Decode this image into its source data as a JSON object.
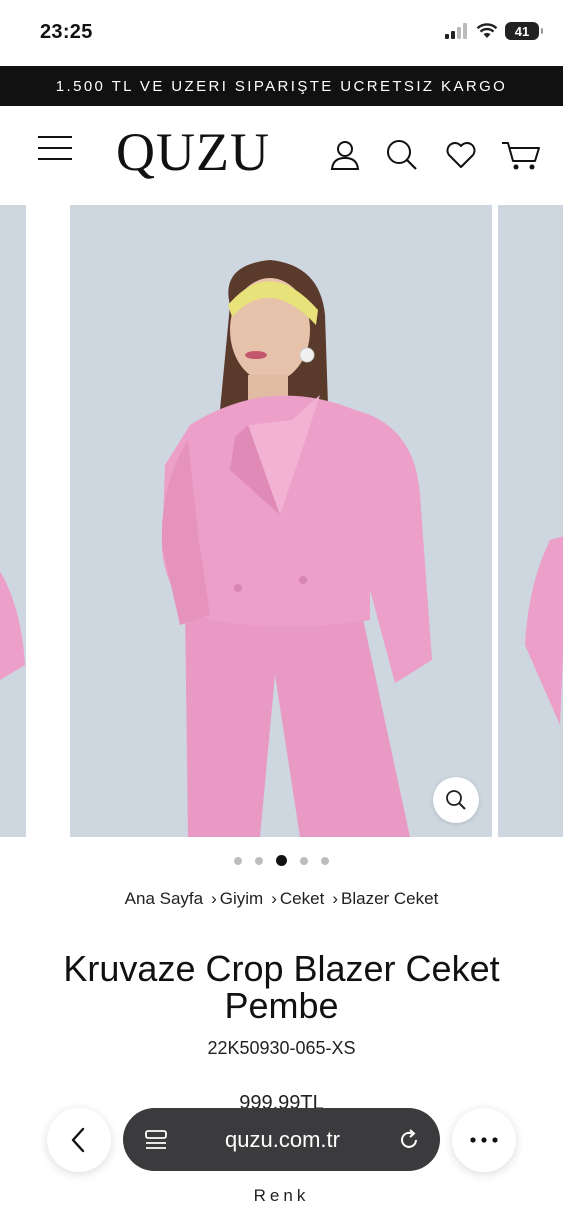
{
  "status_bar": {
    "time": "23:25",
    "battery": "41"
  },
  "promo": {
    "text": "1.500 TL VE UZERI SIPARIŞTE UCRETSIZ KARGO"
  },
  "header": {
    "logo": "QUZU"
  },
  "breadcrumb": [
    "Ana Sayfa",
    "Giyim",
    "Ceket",
    "Blazer Ceket"
  ],
  "product": {
    "title": "Kruvaze Crop Blazer Ceket Pembe",
    "sku": "22K50930-065-XS",
    "price": "999,99TL",
    "color_label": "Renk"
  },
  "gallery": {
    "slide_count": 5,
    "active_index": 2
  },
  "browser": {
    "url": "quzu.com.tr"
  },
  "colors": {
    "promo_bg": "#111111",
    "photo_bg": "#ced6e0",
    "blazer_pink": "#ec9fc9",
    "headband": "#e8e27a",
    "url_bar": "#3b3b3d"
  },
  "icons": [
    "menu-icon",
    "user-icon",
    "search-icon",
    "heart-icon",
    "cart-icon",
    "zoom-icon",
    "back-icon",
    "tabs-icon",
    "reload-icon",
    "more-icon"
  ]
}
